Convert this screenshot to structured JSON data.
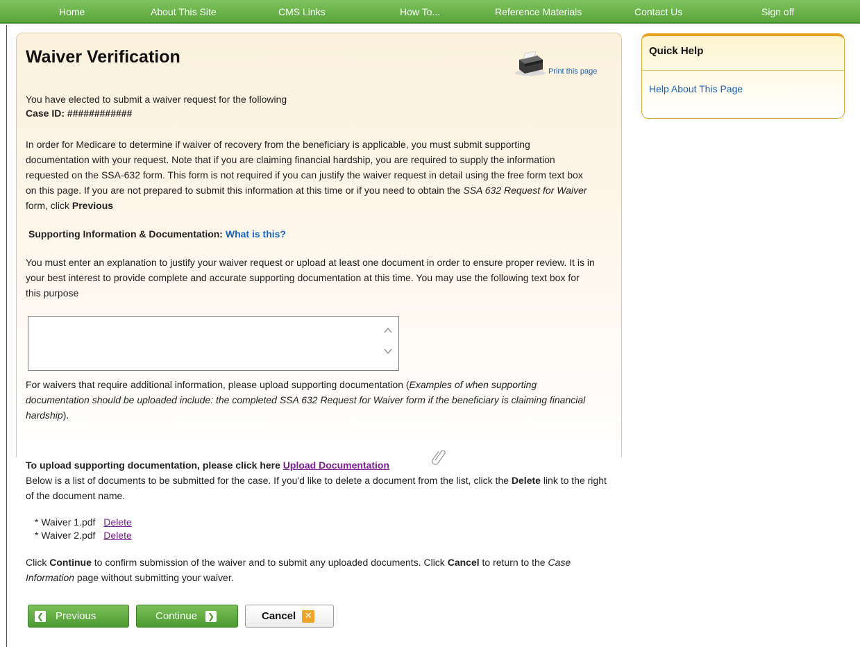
{
  "nav": {
    "items": [
      "Home",
      "About This Site",
      "CMS Links",
      "How To...",
      "Reference Materials",
      "Contact Us",
      "Sign off"
    ]
  },
  "page": {
    "title": "Waiver Verification",
    "print_label": "Print this page",
    "intro_line": "You have elected to submit a waiver request for the following",
    "case_id_label": "Case ID:",
    "case_id_value": "############",
    "para1_a": "In order for Medicare to determine if waiver of recovery from the beneficiary is applicable, you must submit supporting documentation with your request. Note that if you are claiming financial hardship, you are required to supply the information requested on the SSA-632 form. This form is not required if you can justify the waiver request in detail using the free form text box on this page. If you are not prepared to submit this information at this time or if you need to obtain the ",
    "para1_italic": "SSA 632 Request for Waiver",
    "para1_b": " form, click ",
    "para1_bold": "Previous",
    "supporting_heading": "Supporting Information & Documentation:",
    "what_is_this": "What is this?",
    "para2": "You must enter an explanation to justify your waiver request or upload at least one document in order to ensure proper review. It is in your best interest to provide complete and accurate supporting documentation at this time. You may use the following text box for this purpose",
    "textbox_value": "",
    "para3_a": "For waivers that require additional information, please upload supporting documentation (",
    "para3_italic": "Examples of when supporting documentation should be uploaded include: the completed SSA 632 Request for Waiver form if the beneficiary is claiming financial hardship",
    "para3_b": ").",
    "upload_prompt": "To upload supporting documentation, please click here",
    "upload_link": "Upload Documentation",
    "list_intro_a": "Below is a list of documents to be submitted for the case. If you'd like to delete a document from the list, click the ",
    "list_intro_bold": "Delete",
    "list_intro_b": " link to the right of the document name.",
    "documents": [
      {
        "name": "* Waiver 1.pdf",
        "delete_label": "Delete"
      },
      {
        "name": "* Waiver 2.pdf",
        "delete_label": "Delete"
      }
    ],
    "confirm_a": "Click ",
    "confirm_bold1": "Continue",
    "confirm_b": " to confirm submission of the waiver and to submit any uploaded documents. Click ",
    "confirm_bold2": "Cancel",
    "confirm_c": " to return to the ",
    "confirm_italic": "Case Information",
    "confirm_d": " page without submitting your waiver."
  },
  "buttons": {
    "previous": "Previous",
    "continue": "Continue",
    "cancel": "Cancel"
  },
  "quick_help": {
    "title": "Quick Help",
    "link": "Help About This Page"
  },
  "colors": {
    "nav_green": "#5aa53b",
    "link_blue": "#1565c0",
    "link_purple": "#7a1f8f",
    "help_orange": "#e8a020"
  }
}
